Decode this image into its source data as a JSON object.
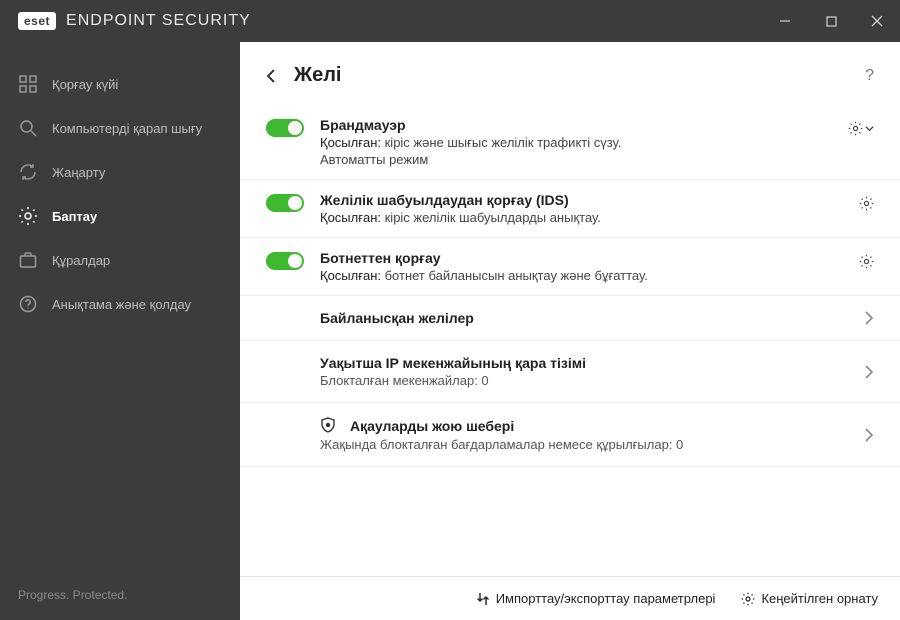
{
  "titlebar": {
    "brand_badge": "eset",
    "brand_text": "ENDPOINT SECURITY"
  },
  "sidebar": {
    "items": [
      {
        "label": "Қорғау күйі"
      },
      {
        "label": "Компьютерді қарап шығу"
      },
      {
        "label": "Жаңарту"
      },
      {
        "label": "Баптау"
      },
      {
        "label": "Құралдар"
      },
      {
        "label": "Анықтама және қолдау"
      }
    ],
    "footer": "Progress. Protected."
  },
  "page": {
    "title": "Желі"
  },
  "sections": {
    "firewall": {
      "title": "Брандмауэр",
      "status_lead": "Қосылған:",
      "status_rest": " кіріс және шығыс желілік трафикті сүзу.",
      "extra": "Автоматты режим"
    },
    "ids": {
      "title": "Желілік шабуылдаудан қорғау (IDS)",
      "status_lead": "Қосылған:",
      "status_rest": " кіріс желілік шабуылдарды анықтау."
    },
    "botnet": {
      "title": "Ботнеттен қорғау",
      "status_lead": "Қосылған:",
      "status_rest": " ботнет байланысын анықтау және бұғаттау."
    }
  },
  "nav": {
    "connected": {
      "title": "Байланысқан желілер"
    },
    "blacklist": {
      "title": "Уақытша IP мекенжайының қара тізімі",
      "sub": "Блокталған мекенжайлар: 0"
    },
    "troubleshoot": {
      "title": "Ақауларды жою шебері",
      "sub": "Жақында блокталған бағдарламалар немесе құрылғылар: 0"
    }
  },
  "footer": {
    "import_export": "Импорттау/экспорттау параметрлері",
    "advanced": "Кеңейтілген орнату"
  }
}
